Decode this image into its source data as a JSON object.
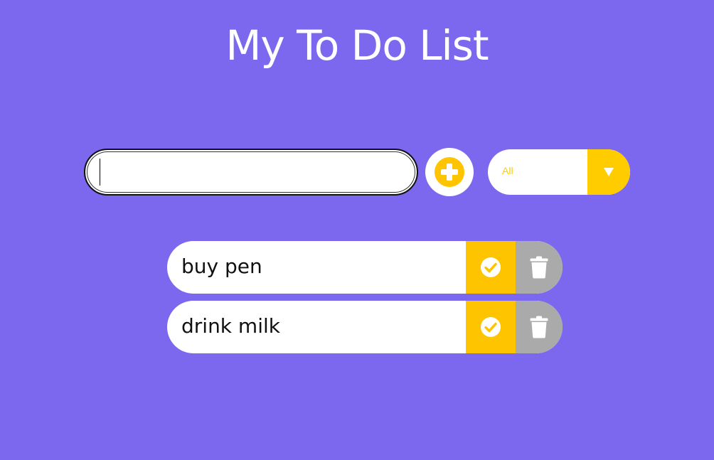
{
  "header": {
    "title": "My To Do List"
  },
  "form": {
    "input_value": "",
    "filter_selected": "All"
  },
  "todos": [
    {
      "text": "buy pen"
    },
    {
      "text": "drink milk"
    }
  ],
  "icons": {
    "add": "plus-circle-icon",
    "filter_arrow": "triangle-down-icon",
    "complete": "check-circle-icon",
    "delete": "trash-icon"
  },
  "colors": {
    "background": "#7b68ee",
    "accent": "#ffc400",
    "delete": "#aaaaaa"
  }
}
